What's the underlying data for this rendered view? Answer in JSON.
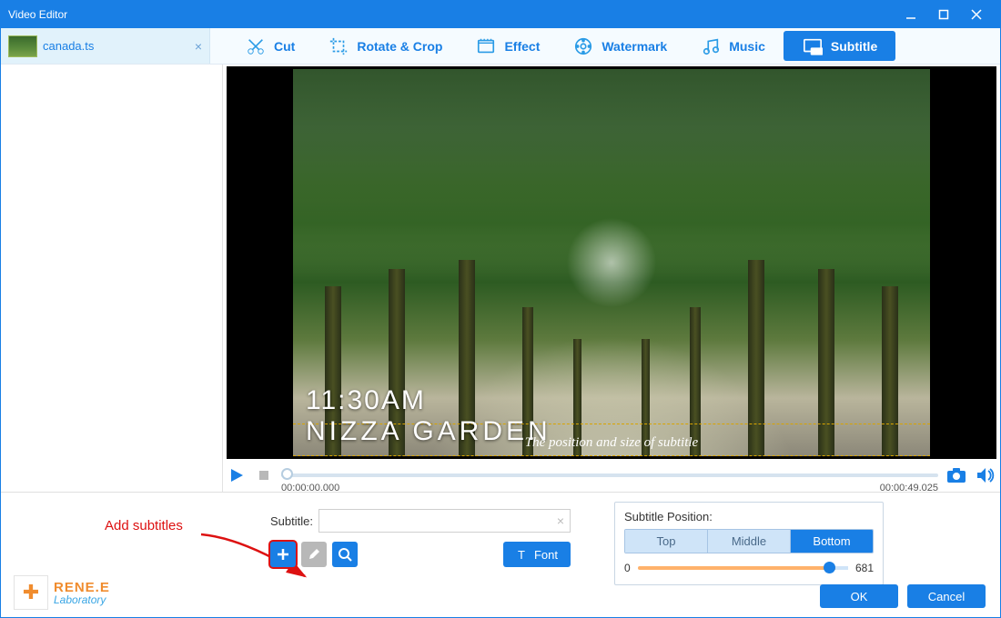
{
  "window": {
    "title": "Video Editor"
  },
  "file_tab": {
    "name": "canada.ts"
  },
  "tabs": [
    {
      "label": "Cut"
    },
    {
      "label": "Rotate & Crop"
    },
    {
      "label": "Effect"
    },
    {
      "label": "Watermark"
    },
    {
      "label": "Music"
    },
    {
      "label": "Subtitle"
    }
  ],
  "video_overlay": {
    "time": "11:30AM",
    "place": "NIZZA GARDEN",
    "subtitle_hint": "The position and size of subtitle"
  },
  "player": {
    "current_time": "00:00:00.000",
    "total_time": "00:00:49.025"
  },
  "annotation": "Add subtitles",
  "subtitle_panel": {
    "label": "Subtitle:",
    "input_value": "",
    "font_btn": "Font"
  },
  "position_panel": {
    "header": "Subtitle Position:",
    "options": [
      "Top",
      "Middle",
      "Bottom"
    ],
    "slider_min": "0",
    "slider_max": "681"
  },
  "logo": {
    "brand": "RENE.E",
    "sub": "Laboratory"
  },
  "dialog": {
    "ok": "OK",
    "cancel": "Cancel"
  }
}
